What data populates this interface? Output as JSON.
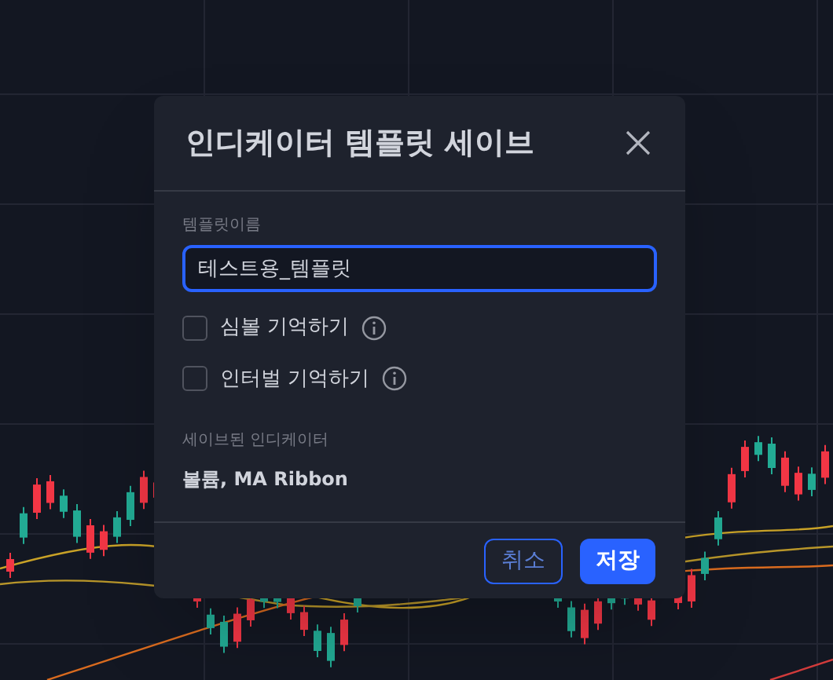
{
  "dialog": {
    "title": "인디케이터 템플릿 세이브",
    "name_field": {
      "label": "템플릿이름",
      "value": "테스트용_템플릿",
      "focused": true
    },
    "options": [
      {
        "label": "심볼 기억하기",
        "checked": false
      },
      {
        "label": "인터벌 기억하기",
        "checked": false
      }
    ],
    "saved_indicators": {
      "label": "세이브된 인디케이터",
      "value": "볼륨, MA Ribbon"
    },
    "buttons": [
      {
        "label": "취소",
        "kind": "secondary"
      },
      {
        "label": "저장",
        "kind": "primary"
      }
    ]
  }
}
